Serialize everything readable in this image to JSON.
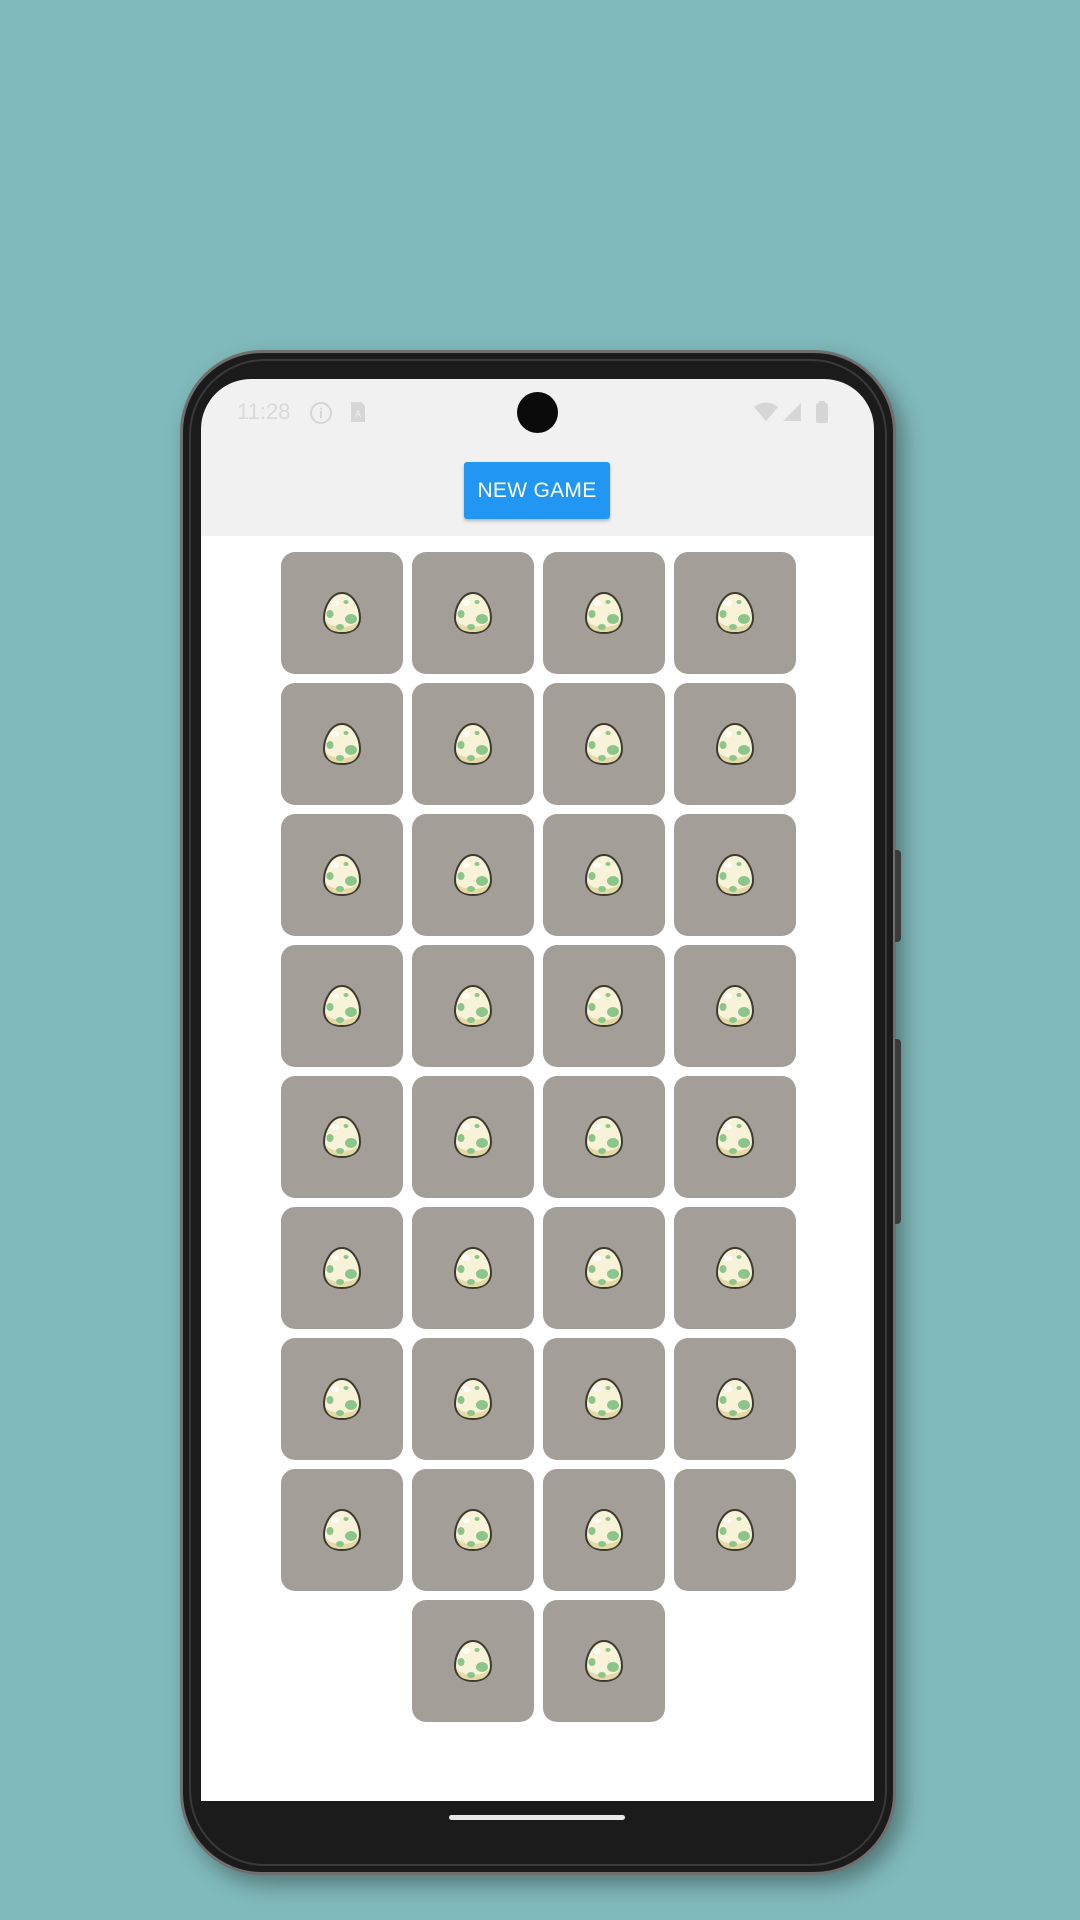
{
  "status_bar": {
    "time": "11:28",
    "icons": [
      "info-icon",
      "sim-icon",
      "wifi-icon",
      "signal-icon",
      "battery-icon"
    ]
  },
  "toolbar": {
    "new_game_label": "NEW GAME"
  },
  "board": {
    "card_count": 34,
    "columns": 4,
    "card_back_icon": "egg-icon",
    "colors": {
      "card_back": "#a39e98",
      "button": "#2196f3",
      "background": "#81babc"
    }
  }
}
